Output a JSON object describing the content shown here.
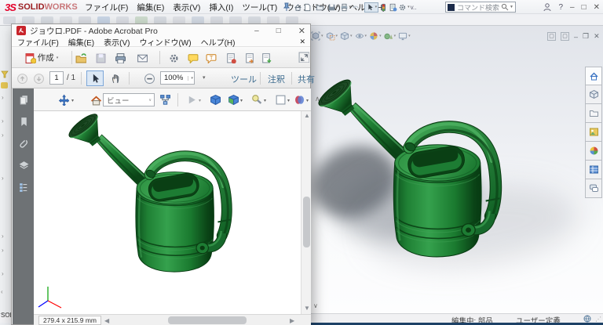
{
  "solidworks": {
    "logo": {
      "mark": "3S",
      "text_solid": "SOLID",
      "text_works": "WORKS"
    },
    "menubar": [
      "ファイル(F)",
      "編集(E)",
      "表示(V)",
      "挿入(I)",
      "ツール(T)",
      "ウィンドウ(W)",
      "ヘルプ(H)"
    ],
    "quick_toolbar": [
      "home-icon",
      "new-document-icon",
      "open-icon",
      "save-icon",
      "print-icon",
      "undo-icon",
      "select-arrow-icon",
      "rebuild-traffic-light-icon",
      "file-properties-icon",
      "options-gear-icon"
    ],
    "quick_toolbar_overflow": "v..",
    "search": {
      "placeholder": "コマンド検索"
    },
    "titlebar_right": {
      "help_label": "?"
    },
    "heads_up_toolbar": [
      "zoom-fit-icon",
      "zoom-area-icon",
      "view-orientation-cube-icon",
      "hide-show-eye-icon",
      "appearance-sphere-icon",
      "scene-icon",
      "monitor-icon"
    ],
    "task_pane_tabs": [
      "home-tab-icon",
      "toolbox-tab-icon",
      "design-library-folder-icon",
      "appearances-tab-icon",
      "forum-tab-icon",
      "custom-properties-tab-icon",
      "comments-chat-icon"
    ],
    "statusbar": {
      "editing_label": "編集中: 部品",
      "units_label": "ユーザー定義"
    },
    "left_strip_text": "SOL"
  },
  "acrobat": {
    "title": "ジョウロ.PDF - Adobe Acrobat Pro",
    "menubar": [
      "ファイル(F)",
      "編集(E)",
      "表示(V)",
      "ウィンドウ(W)",
      "ヘルプ(H)"
    ],
    "toolbar": {
      "create_label": "作成",
      "icons": [
        "create-pdf-icon",
        "open-folder-icon",
        "save-icon",
        "print-icon",
        "email-icon",
        "gear-icon",
        "comment-bubble-icon",
        "text-callout-icon",
        "attach-doc-red-icon",
        "attach-doc-orange-icon",
        "attach-doc-green-icon",
        "expand-toolbar-icon"
      ]
    },
    "nav": {
      "page_value": "1",
      "page_total": "/ 1",
      "zoom_value": "100%",
      "tools_label": "ツール",
      "comment_label": "注釈",
      "share_label": "共有"
    },
    "toolbar3d": {
      "view_combo_value": "ビュー",
      "icons": [
        "rotate-3d-icon",
        "home-view-icon",
        "model-tree-icon",
        "play-animation-icon",
        "render-cube-icon",
        "render-mode-cube-icon",
        "light-icon",
        "background-color-icon",
        "cross-section-icon",
        "collapse-toolbar-icon"
      ]
    },
    "sidebar_icons": [
      "page-thumbnails-icon",
      "bookmarks-icon",
      "attachments-paperclip-icon",
      "layers-icon",
      "model-tree-panel-icon"
    ],
    "statusbar": {
      "page_size": "279.4 x 215.9 mm"
    }
  },
  "model": {
    "object": "green watering can 3D model",
    "green_main": "#2f9c47",
    "green_dark": "#0b4418",
    "green_light": "#4aae60"
  }
}
